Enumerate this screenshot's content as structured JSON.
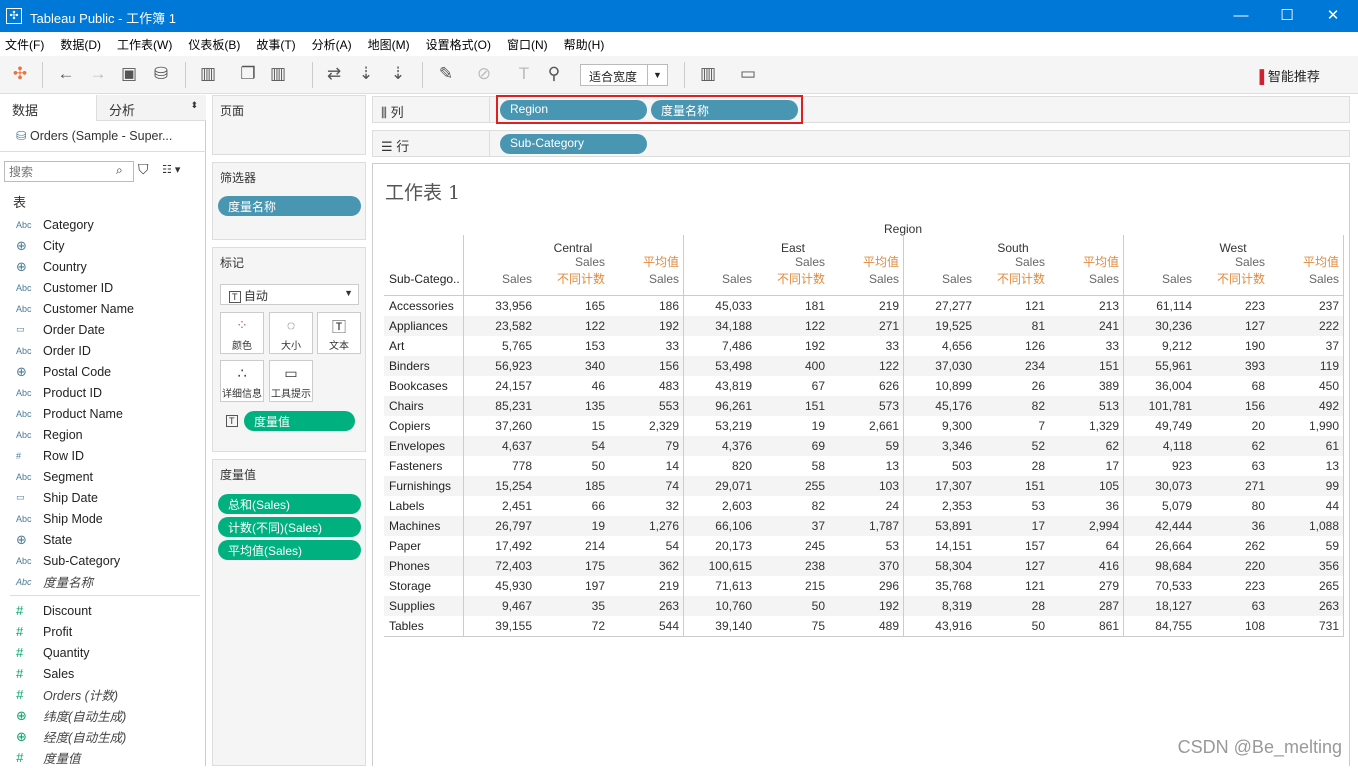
{
  "window": {
    "title": "Tableau Public - 工作簿 1",
    "min": "—",
    "max": "☐",
    "close": "✕"
  },
  "menu": [
    "文件(F)",
    "数据(D)",
    "工作表(W)",
    "仪表板(B)",
    "故事(T)",
    "分析(A)",
    "地图(M)",
    "设置格式(O)",
    "窗口(N)",
    "帮助(H)"
  ],
  "toolbar": {
    "fit": "适合宽度",
    "smart": "智能推荐"
  },
  "left": {
    "tab_data": "数据",
    "tab_analysis": "分析",
    "datasource": "Orders (Sample - Super...",
    "search_placeholder": "搜索",
    "table_label": "表",
    "dimensions": [
      {
        "t": "abc",
        "n": "Category"
      },
      {
        "t": "geo",
        "n": "City"
      },
      {
        "t": "geo",
        "n": "Country"
      },
      {
        "t": "abc",
        "n": "Customer ID"
      },
      {
        "t": "abc",
        "n": "Customer Name"
      },
      {
        "t": "date",
        "n": "Order Date"
      },
      {
        "t": "abc",
        "n": "Order ID"
      },
      {
        "t": "geo",
        "n": "Postal Code"
      },
      {
        "t": "abc",
        "n": "Product ID"
      },
      {
        "t": "abc",
        "n": "Product Name"
      },
      {
        "t": "abc",
        "n": "Region"
      },
      {
        "t": "num",
        "n": "Row ID"
      },
      {
        "t": "abc",
        "n": "Segment"
      },
      {
        "t": "date",
        "n": "Ship Date"
      },
      {
        "t": "abc",
        "n": "Ship Mode"
      },
      {
        "t": "geo",
        "n": "State"
      },
      {
        "t": "abc",
        "n": "Sub-Category"
      },
      {
        "t": "abc",
        "n": "度量名称",
        "i": true
      }
    ],
    "measures": [
      {
        "t": "num",
        "n": "Discount"
      },
      {
        "t": "num",
        "n": "Profit"
      },
      {
        "t": "num",
        "n": "Quantity"
      },
      {
        "t": "num",
        "n": "Sales"
      },
      {
        "t": "num",
        "n": "Orders (计数)",
        "i": true
      },
      {
        "t": "geo",
        "n": "纬度(自动生成)",
        "i": true
      },
      {
        "t": "geo",
        "n": "经度(自动生成)",
        "i": true
      },
      {
        "t": "num",
        "n": "度量值",
        "i": true
      }
    ]
  },
  "cards": {
    "pages": "页面",
    "filters": "筛选器",
    "filter_pill": "度量名称",
    "marks": "标记",
    "mark_type": "自动",
    "color": "颜色",
    "size": "大小",
    "text": "文本",
    "detail": "详细信息",
    "tooltip": "工具提示",
    "marks_pill": "度量值",
    "measure_values": "度量值",
    "mv_pills": [
      "总和(Sales)",
      "计数(不同)(Sales)",
      "平均值(Sales)"
    ]
  },
  "shelves": {
    "columns_label": "列",
    "rows_label": "行",
    "columns": [
      "Region",
      "度量名称"
    ],
    "rows": [
      "Sub-Category"
    ]
  },
  "sheet": {
    "title": "工作表 1",
    "region_header": "Region",
    "row_header": "Sub-Catego..",
    "regions": [
      "Central",
      "East",
      "South",
      "West"
    ],
    "measure_headers": [
      {
        "top": "",
        "bottom": "Sales"
      },
      {
        "top": "Sales",
        "bottom": "不同计数"
      },
      {
        "top": "平均值",
        "bottom": "Sales"
      }
    ],
    "rows": [
      [
        "Accessories",
        "33,956",
        "165",
        "186",
        "45,033",
        "181",
        "219",
        "27,277",
        "121",
        "213",
        "61,114",
        "223",
        "237"
      ],
      [
        "Appliances",
        "23,582",
        "122",
        "192",
        "34,188",
        "122",
        "271",
        "19,525",
        "81",
        "241",
        "30,236",
        "127",
        "222"
      ],
      [
        "Art",
        "5,765",
        "153",
        "33",
        "7,486",
        "192",
        "33",
        "4,656",
        "126",
        "33",
        "9,212",
        "190",
        "37"
      ],
      [
        "Binders",
        "56,923",
        "340",
        "156",
        "53,498",
        "400",
        "122",
        "37,030",
        "234",
        "151",
        "55,961",
        "393",
        "119"
      ],
      [
        "Bookcases",
        "24,157",
        "46",
        "483",
        "43,819",
        "67",
        "626",
        "10,899",
        "26",
        "389",
        "36,004",
        "68",
        "450"
      ],
      [
        "Chairs",
        "85,231",
        "135",
        "553",
        "96,261",
        "151",
        "573",
        "45,176",
        "82",
        "513",
        "101,781",
        "156",
        "492"
      ],
      [
        "Copiers",
        "37,260",
        "15",
        "2,329",
        "53,219",
        "19",
        "2,661",
        "9,300",
        "7",
        "1,329",
        "49,749",
        "20",
        "1,990"
      ],
      [
        "Envelopes",
        "4,637",
        "54",
        "79",
        "4,376",
        "69",
        "59",
        "3,346",
        "52",
        "62",
        "4,118",
        "62",
        "61"
      ],
      [
        "Fasteners",
        "778",
        "50",
        "14",
        "820",
        "58",
        "13",
        "503",
        "28",
        "17",
        "923",
        "63",
        "13"
      ],
      [
        "Furnishings",
        "15,254",
        "185",
        "74",
        "29,071",
        "255",
        "103",
        "17,307",
        "151",
        "105",
        "30,073",
        "271",
        "99"
      ],
      [
        "Labels",
        "2,451",
        "66",
        "32",
        "2,603",
        "82",
        "24",
        "2,353",
        "53",
        "36",
        "5,079",
        "80",
        "44"
      ],
      [
        "Machines",
        "26,797",
        "19",
        "1,276",
        "66,106",
        "37",
        "1,787",
        "53,891",
        "17",
        "2,994",
        "42,444",
        "36",
        "1,088"
      ],
      [
        "Paper",
        "17,492",
        "214",
        "54",
        "20,173",
        "245",
        "53",
        "14,151",
        "157",
        "64",
        "26,664",
        "262",
        "59"
      ],
      [
        "Phones",
        "72,403",
        "175",
        "362",
        "100,615",
        "238",
        "370",
        "58,304",
        "127",
        "416",
        "98,684",
        "220",
        "356"
      ],
      [
        "Storage",
        "45,930",
        "197",
        "219",
        "71,613",
        "215",
        "296",
        "35,768",
        "121",
        "279",
        "70,533",
        "223",
        "265"
      ],
      [
        "Supplies",
        "9,467",
        "35",
        "263",
        "10,760",
        "50",
        "192",
        "8,319",
        "28",
        "287",
        "18,127",
        "63",
        "263"
      ],
      [
        "Tables",
        "39,155",
        "72",
        "544",
        "39,140",
        "75",
        "489",
        "43,916",
        "50",
        "861",
        "84,755",
        "108",
        "731"
      ]
    ]
  },
  "watermark": "CSDN @Be_melting",
  "colors": {
    "titlebar": "#0078d7",
    "dimension_pill": "#4996b2",
    "measure_pill": "#00b180",
    "highlight": "#e02020"
  }
}
